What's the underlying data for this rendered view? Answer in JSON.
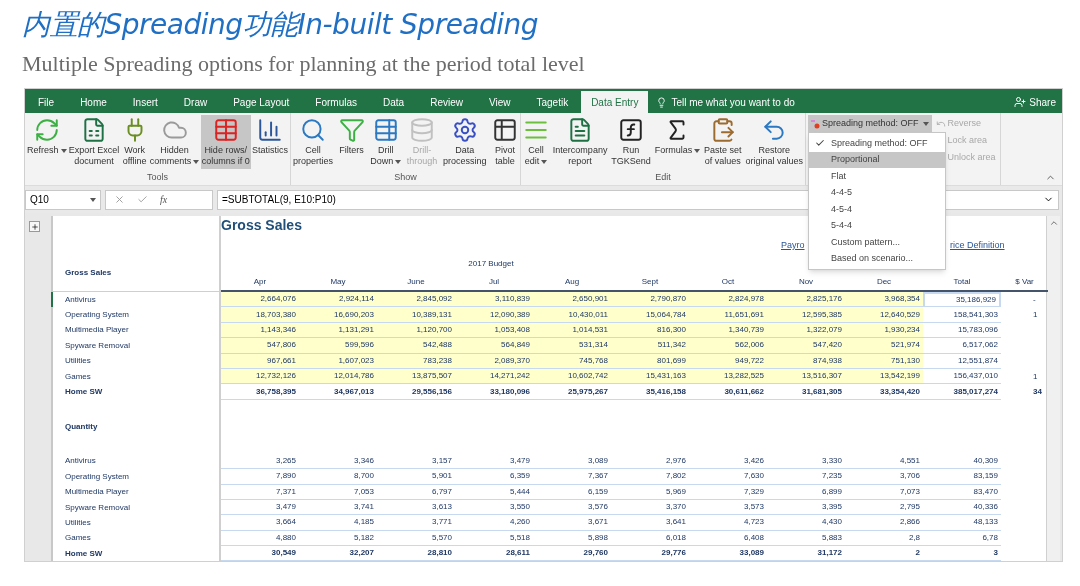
{
  "slide": {
    "title": "内置的Spreading功能In-built Spreading",
    "subtitle": "Multiple Spreading options for planning at the period total level"
  },
  "tabs": [
    {
      "label": "File",
      "selected": false
    },
    {
      "label": "Home",
      "selected": false
    },
    {
      "label": "Insert",
      "selected": false
    },
    {
      "label": "Draw",
      "selected": false
    },
    {
      "label": "Page Layout",
      "selected": false
    },
    {
      "label": "Formulas",
      "selected": false
    },
    {
      "label": "Data",
      "selected": false
    },
    {
      "label": "Review",
      "selected": false
    },
    {
      "label": "View",
      "selected": false
    },
    {
      "label": "Tagetik",
      "selected": false
    },
    {
      "label": "Data Entry",
      "selected": true
    }
  ],
  "tell_me": "Tell me what you want to do",
  "share": "Share",
  "ribbon_groups": [
    {
      "label": "Tools",
      "buttons": [
        {
          "label": "Refresh",
          "selected": false,
          "disabled": false,
          "dropdown": true
        },
        {
          "label": "Export Excel\ndocument",
          "selected": false,
          "disabled": false,
          "dropdown": false
        },
        {
          "label": "Work\noffline",
          "selected": false,
          "disabled": false,
          "dropdown": false
        },
        {
          "label": "Hidden\ncomments",
          "selected": false,
          "disabled": false,
          "dropdown": true
        },
        {
          "label": "Hide rows/\ncolumns if 0",
          "selected": true,
          "disabled": false,
          "dropdown": false
        },
        {
          "label": "Statistics",
          "selected": false,
          "disabled": false,
          "dropdown": false
        }
      ]
    },
    {
      "label": "Show",
      "buttons": [
        {
          "label": "Cell\nproperties",
          "selected": false,
          "disabled": false,
          "dropdown": false
        },
        {
          "label": "Filters",
          "selected": false,
          "disabled": false,
          "dropdown": false
        },
        {
          "label": "Drill\nDown",
          "selected": false,
          "disabled": false,
          "dropdown": true
        },
        {
          "label": "Drill-\nthrough",
          "selected": false,
          "disabled": true,
          "dropdown": false
        },
        {
          "label": "Data\nprocessing",
          "selected": false,
          "disabled": false,
          "dropdown": false
        },
        {
          "label": "Pivot\ntable",
          "selected": false,
          "disabled": false,
          "dropdown": false
        }
      ]
    },
    {
      "label": "Edit",
      "buttons": [
        {
          "label": "Cell\nedit",
          "selected": false,
          "disabled": false,
          "dropdown": true
        },
        {
          "label": "Intercompany\nreport",
          "selected": false,
          "disabled": false,
          "dropdown": false
        },
        {
          "label": "Run\nTGKSend",
          "selected": false,
          "disabled": false,
          "dropdown": false
        },
        {
          "label": "Formulas",
          "selected": false,
          "disabled": false,
          "dropdown": true
        },
        {
          "label": "Paste set\nof values",
          "selected": false,
          "disabled": false,
          "dropdown": false
        },
        {
          "label": "Restore\noriginal values",
          "selected": false,
          "disabled": false,
          "dropdown": false
        }
      ]
    }
  ],
  "spreading": {
    "button": {
      "label": "Spreading method: OFF",
      "selected": true
    },
    "side_items": [
      {
        "label": "Reverse",
        "disabled": true
      },
      {
        "label": "Lock area",
        "disabled": true
      },
      {
        "label": "Unlock area",
        "disabled": true
      }
    ],
    "menu": [
      {
        "label": "Spreading method: OFF",
        "checked": true,
        "selected": false
      },
      {
        "label": "Proportional",
        "checked": false,
        "selected": true
      },
      {
        "label": "Flat",
        "checked": false,
        "selected": false
      },
      {
        "label": "4-4-5",
        "checked": false,
        "selected": false
      },
      {
        "label": "4-5-4",
        "checked": false,
        "selected": false
      },
      {
        "label": "5-4-4",
        "checked": false,
        "selected": false
      },
      {
        "label": "Custom pattern...",
        "checked": false,
        "selected": false
      },
      {
        "label": "Based on scenario...",
        "checked": false,
        "selected": false
      }
    ]
  },
  "formula_bar": {
    "name_box": "Q10",
    "fx": "fx",
    "formula": "=SUBTOTAL(9, E10:P10)"
  },
  "sheet": {
    "title": "Gross Sales",
    "links": [
      "Payro",
      "rice Definition"
    ],
    "header_label": "Gross Sales",
    "budget_label": "2017 Budget",
    "columns": [
      "Apr",
      "May",
      "June",
      "Jul",
      "Aug",
      "Sept",
      "Oct",
      "Nov",
      "Dec",
      "Total",
      "$ Var"
    ],
    "sections": [
      {
        "rows": [
          {
            "label": "Antivirus",
            "kind": "input",
            "selected": true,
            "values": [
              "2,664,076",
              "2,924,114",
              "2,845,092",
              "3,110,839",
              "2,650,901",
              "2,790,870",
              "2,824,978",
              "2,825,176",
              "3,968,354",
              "35,186,929",
              "-"
            ]
          },
          {
            "label": "Operating System",
            "kind": "input",
            "selected": false,
            "values": [
              "18,703,380",
              "16,690,203",
              "10,389,131",
              "12,090,389",
              "10,430,011",
              "15,064,784",
              "11,651,691",
              "12,595,385",
              "12,640,529",
              "158,541,303",
              "1"
            ]
          },
          {
            "label": "Multimedia Player",
            "kind": "input",
            "selected": false,
            "values": [
              "1,143,346",
              "1,131,291",
              "1,120,700",
              "1,053,408",
              "1,014,531",
              "816,300",
              "1,340,739",
              "1,322,079",
              "1,930,234",
              "15,783,096"
            ]
          },
          {
            "label": "Spyware Removal",
            "kind": "input",
            "selected": false,
            "values": [
              "547,806",
              "599,596",
              "542,488",
              "564,849",
              "531,314",
              "511,342",
              "562,006",
              "547,420",
              "521,974",
              "6,517,062"
            ]
          },
          {
            "label": "Utilities",
            "kind": "input",
            "selected": false,
            "values": [
              "967,661",
              "1,607,023",
              "783,238",
              "2,089,370",
              "745,768",
              "801,699",
              "949,722",
              "874,938",
              "751,130",
              "12,551,874"
            ]
          },
          {
            "label": "Games",
            "kind": "input",
            "selected": false,
            "values": [
              "12,732,126",
              "12,014,786",
              "13,875,507",
              "14,271,242",
              "10,602,742",
              "15,431,163",
              "13,282,525",
              "13,516,307",
              "13,542,199",
              "156,437,010",
              "1"
            ]
          },
          {
            "label": "Home SW",
            "kind": "total",
            "selected": false,
            "values": [
              "36,758,395",
              "34,967,013",
              "29,556,156",
              "33,180,096",
              "25,975,267",
              "35,416,158",
              "30,611,662",
              "31,681,305",
              "33,354,420",
              "385,017,274",
              "34"
            ]
          }
        ]
      },
      {
        "heading": "Quantity",
        "rows": [
          {
            "label": "Antivirus",
            "kind": "plain",
            "selected": false,
            "values": [
              "3,265",
              "3,346",
              "3,157",
              "3,479",
              "3,089",
              "2,976",
              "3,426",
              "3,330",
              "4,551",
              "40,309"
            ]
          },
          {
            "label": "Operating System",
            "kind": "plain",
            "selected": false,
            "values": [
              "7,890",
              "8,700",
              "5,901",
              "6,359",
              "7,367",
              "7,802",
              "7,630",
              "7,235",
              "3,706",
              "83,159"
            ]
          },
          {
            "label": "Multimedia Player",
            "kind": "plain",
            "selected": false,
            "values": [
              "7,371",
              "7,053",
              "6,797",
              "5,444",
              "6,159",
              "5,969",
              "7,329",
              "6,899",
              "7,073",
              "83,470"
            ]
          },
          {
            "label": "Spyware Removal",
            "kind": "plain",
            "selected": false,
            "values": [
              "3,479",
              "3,741",
              "3,613",
              "3,550",
              "3,576",
              "3,370",
              "3,573",
              "3,395",
              "2,795",
              "40,336"
            ]
          },
          {
            "label": "Utilities",
            "kind": "plain",
            "selected": false,
            "values": [
              "3,664",
              "4,185",
              "3,771",
              "4,260",
              "3,671",
              "3,641",
              "4,723",
              "4,430",
              "2,866",
              "48,133"
            ]
          },
          {
            "label": "Games",
            "kind": "plain",
            "selected": false,
            "values": [
              "4,880",
              "5,182",
              "5,570",
              "5,518",
              "5,898",
              "6,018",
              "6,408",
              "5,883",
              "2,8",
              "6,78"
            ]
          },
          {
            "label": "Home SW",
            "kind": "total",
            "selected": false,
            "values": [
              "30,549",
              "32,207",
              "28,810",
              "28,611",
              "29,760",
              "29,776",
              "33,089",
              "31,172",
              "2",
              "3"
            ]
          }
        ]
      }
    ]
  }
}
